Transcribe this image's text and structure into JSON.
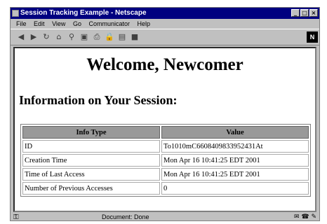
{
  "window": {
    "title": "Session Tracking Example - Netscape"
  },
  "menu": [
    "File",
    "Edit",
    "View",
    "Go",
    "Communicator",
    "Help"
  ],
  "toolbar": {
    "icons": [
      "back-icon",
      "forward-icon",
      "reload-icon",
      "home-icon",
      "search-icon",
      "netscape-guide-icon",
      "print-icon",
      "security-icon",
      "shop-icon",
      "stop-icon"
    ],
    "logo_letter": "N"
  },
  "page": {
    "heading": "Welcome, Newcomer",
    "subheading": "Information on Your Session:",
    "table": {
      "headers": [
        "Info Type",
        "Value"
      ],
      "rows": [
        [
          "ID",
          "To1010mC6608409833952431At"
        ],
        [
          "Creation Time",
          "Mon Apr 16 10:41:25 EDT 2001"
        ],
        [
          "Time of Last Access",
          "Mon Apr 16 10:41:25 EDT 2001"
        ],
        [
          "Number of Previous Accesses",
          "0"
        ]
      ]
    }
  },
  "status": {
    "text": "Document: Done"
  }
}
